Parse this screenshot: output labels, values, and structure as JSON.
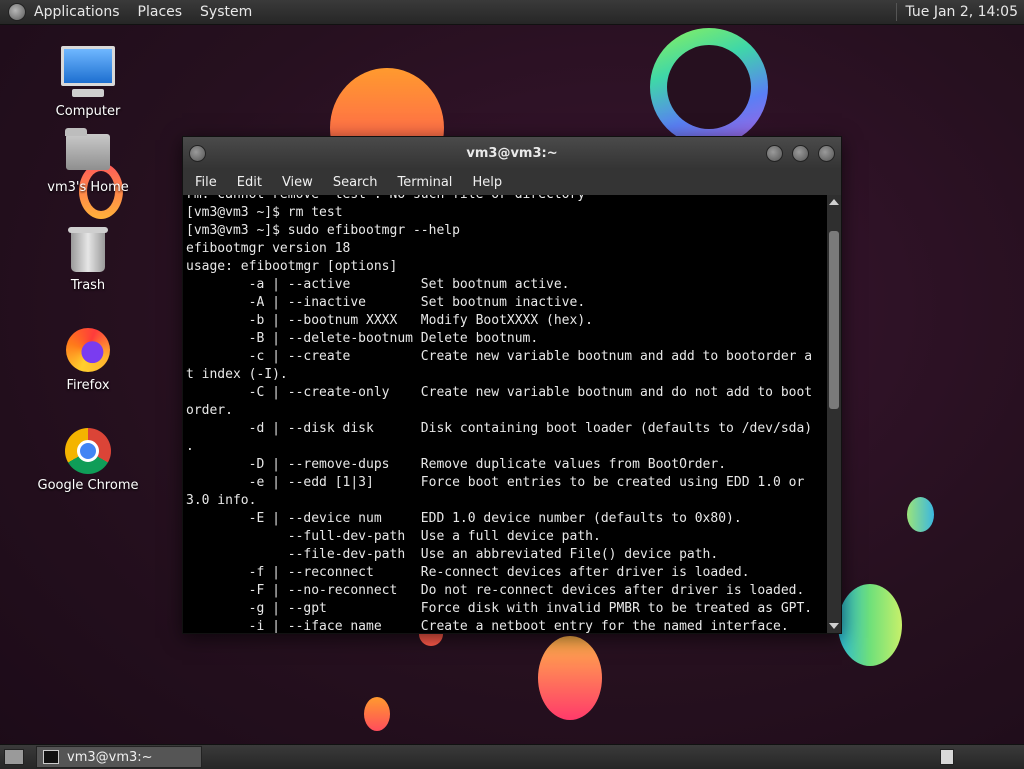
{
  "top_panel": {
    "menus": [
      "Applications",
      "Places",
      "System"
    ],
    "clock": "Tue Jan  2, 14:05"
  },
  "desktop_icons": {
    "computer": "Computer",
    "home": "vm3's Home",
    "trash": "Trash",
    "firefox": "Firefox",
    "chrome": "Google Chrome"
  },
  "window": {
    "title": "vm3@vm3:~",
    "menu": [
      "File",
      "Edit",
      "View",
      "Search",
      "Terminal",
      "Help"
    ]
  },
  "terminal": {
    "lines": [
      "rm: cannot remove 'test': No such file or directory",
      "[vm3@vm3 ~]$ rm test",
      "[vm3@vm3 ~]$ sudo efibootmgr --help",
      "efibootmgr version 18",
      "usage: efibootmgr [options]",
      "        -a | --active         Set bootnum active.",
      "        -A | --inactive       Set bootnum inactive.",
      "        -b | --bootnum XXXX   Modify BootXXXX (hex).",
      "        -B | --delete-bootnum Delete bootnum.",
      "        -c | --create         Create new variable bootnum and add to bootorder a",
      "t index (-I).",
      "        -C | --create-only    Create new variable bootnum and do not add to boot",
      "order.",
      "        -d | --disk disk      Disk containing boot loader (defaults to /dev/sda)",
      ".",
      "        -D | --remove-dups    Remove duplicate values from BootOrder.",
      "        -e | --edd [1|3]      Force boot entries to be created using EDD 1.0 or",
      "3.0 info.",
      "        -E | --device num     EDD 1.0 device number (defaults to 0x80).",
      "             --full-dev-path  Use a full device path.",
      "             --file-dev-path  Use an abbreviated File() device path.",
      "        -f | --reconnect      Re-connect devices after driver is loaded.",
      "        -F | --no-reconnect   Do not re-connect devices after driver is loaded.",
      "        -g | --gpt            Force disk with invalid PMBR to be treated as GPT.",
      "        -i | --iface name     Create a netboot entry for the named interface."
    ]
  },
  "taskbar": {
    "task_label": "vm3@vm3:~"
  }
}
